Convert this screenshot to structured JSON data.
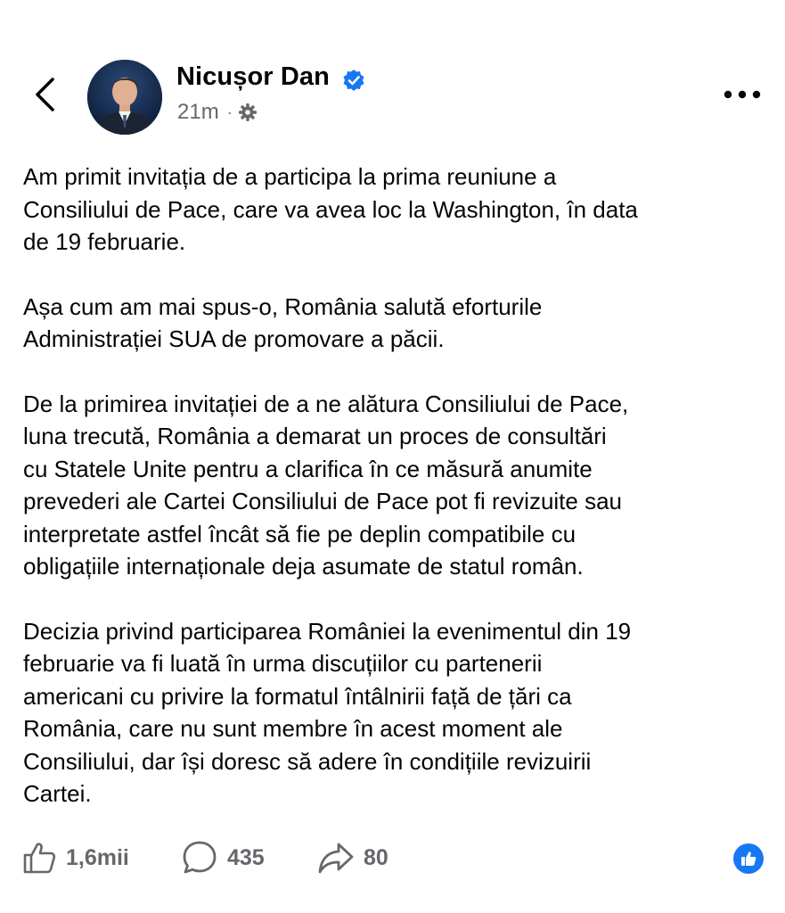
{
  "header": {
    "author_name": "Nicușor Dan",
    "timestamp": "21m",
    "separator": "·",
    "verified": true,
    "audience_icon": "gear-icon"
  },
  "post": {
    "paragraphs": [
      "Am primit invitația de a participa la prima reuniune a\nConsiliului de Pace, care va avea loc la Washington, în data\nde 19 februarie.",
      "Așa cum am mai spus-o, România salută eforturile\nAdministrației SUA de promovare a păcii.",
      "De la primirea invitației de a ne alătura Consiliului de Pace,\nluna trecută, România a demarat un proces de consultări\ncu Statele Unite pentru a clarifica în ce măsură anumite\nprevederi ale Cartei Consiliului de Pace pot fi revizuite sau\ninterpretate astfel încât să fie pe deplin compatibile cu\nobligațiile internaționale deja asumate de statul român.",
      "Decizia privind participarea României la evenimentul din 19\nfebruarie va fi luată în urma discuțiilor cu partenerii\namericani cu privire la formatul întâlnirii față de țări ca\nRomânia, care nu sunt membre în acest moment ale\nConsiliului, dar își doresc să adere în condițiile revizuirii\nCartei."
    ]
  },
  "actions": {
    "likes": "1,6mii",
    "comments": "435",
    "shares": "80"
  },
  "colors": {
    "accent": "#1877f2",
    "secondary_text": "#65676b",
    "primary_text": "#050505"
  }
}
